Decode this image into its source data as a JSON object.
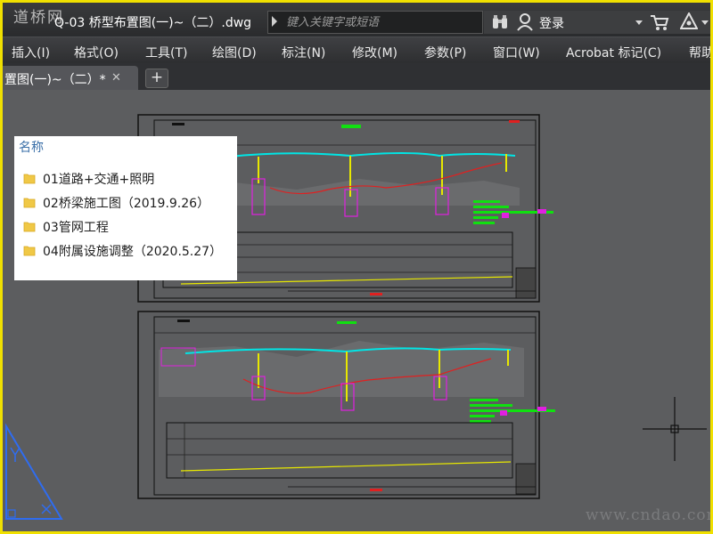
{
  "watermark_top": "道桥网",
  "window": {
    "title": "Q-03 桥型布置图(一)~（二）.dwg",
    "search_placeholder": "键入关键字或短语",
    "login_label": "登录"
  },
  "icons": {
    "binoculars": "binoculars-icon",
    "user": "user-icon",
    "cart": "cart-icon",
    "help": "triangle-help-icon",
    "folder": "folder-icon",
    "ucs": "ucs-icon",
    "crosshair": "crosshair-cursor-icon"
  },
  "menu": [
    {
      "label": "插入(I)"
    },
    {
      "label": "格式(O)"
    },
    {
      "label": "工具(T)"
    },
    {
      "label": "绘图(D)"
    },
    {
      "label": "标注(N)"
    },
    {
      "label": "修改(M)"
    },
    {
      "label": "参数(P)"
    },
    {
      "label": "窗口(W)"
    },
    {
      "label": "Acrobat 标记(C)"
    },
    {
      "label": "帮助"
    }
  ],
  "tabs": [
    {
      "label": "置图(一)~（二）*",
      "close": "✕"
    }
  ],
  "tab_add_label": "+",
  "explorer": {
    "header": "名称",
    "items": [
      {
        "label": "01道路+交通+照明"
      },
      {
        "label": "02桥梁施工图（2019.9.26）"
      },
      {
        "label": "03管网工程"
      },
      {
        "label": "04附属设施调整（2020.5.27）"
      }
    ]
  },
  "watermark_bottom": "www.cndao.com",
  "colors": {
    "frame_border": "#f0e000",
    "canvas_bg": "#5c5d5f",
    "bridge_deck": "#00e5e5",
    "bridge_pier": "#e8e800",
    "annotation_magenta": "#e020e0",
    "annotation_green": "#10e010",
    "ground_line": "#e02020",
    "ucs": "#2f6cf0",
    "explorer_header": "#3a6fa8",
    "folder": "#f0c846"
  }
}
